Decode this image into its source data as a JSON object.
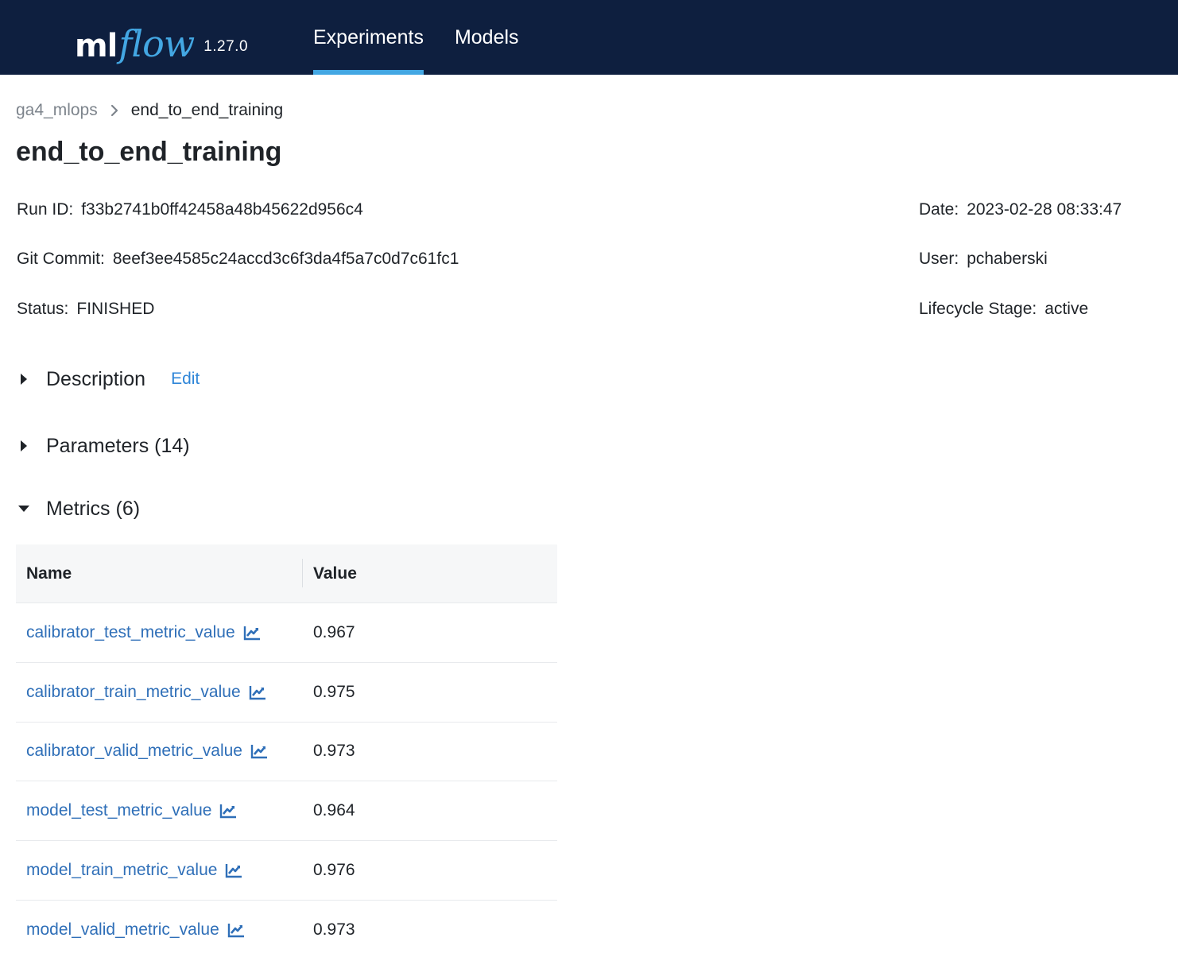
{
  "header": {
    "logo_ml": "ml",
    "logo_flow": "flow",
    "version": "1.27.0",
    "nav": [
      {
        "label": "Experiments",
        "active": true
      },
      {
        "label": "Models",
        "active": false
      }
    ],
    "background_color": "#0e1f3f",
    "accent_color": "#43a7e3"
  },
  "breadcrumb": {
    "parent": "ga4_mlops",
    "separator_icon": "chevron-right-icon",
    "current": "end_to_end_training"
  },
  "page_title": "end_to_end_training",
  "run_info": {
    "run_id": {
      "label": "Run ID:",
      "value": "f33b2741b0ff42458a48b45622d956c4"
    },
    "git_commit": {
      "label": "Git Commit:",
      "value": "8eef3ee4585c24accd3c6f3da4f5a7c0d7c61fc1"
    },
    "status": {
      "label": "Status:",
      "value": "FINISHED"
    },
    "date": {
      "label": "Date:",
      "value": "2023-02-28 08:33:47"
    },
    "user": {
      "label": "User:",
      "value": "pchaberski"
    },
    "lifecycle": {
      "label": "Lifecycle Stage:",
      "value": "active"
    }
  },
  "sections": {
    "description": {
      "title": "Description",
      "edit_label": "Edit",
      "expanded": false
    },
    "parameters": {
      "title": "Parameters (14)",
      "expanded": false
    },
    "metrics": {
      "title": "Metrics (6)",
      "expanded": true
    }
  },
  "metrics_table": {
    "columns": [
      "Name",
      "Value"
    ],
    "rows": [
      {
        "name": "calibrator_test_metric_value",
        "value": "0.967"
      },
      {
        "name": "calibrator_train_metric_value",
        "value": "0.975"
      },
      {
        "name": "calibrator_valid_metric_value",
        "value": "0.973"
      },
      {
        "name": "model_test_metric_value",
        "value": "0.964"
      },
      {
        "name": "model_train_metric_value",
        "value": "0.976"
      },
      {
        "name": "model_valid_metric_value",
        "value": "0.973"
      }
    ],
    "link_color": "#2f6fb8",
    "row_icon": "line-chart-icon"
  }
}
